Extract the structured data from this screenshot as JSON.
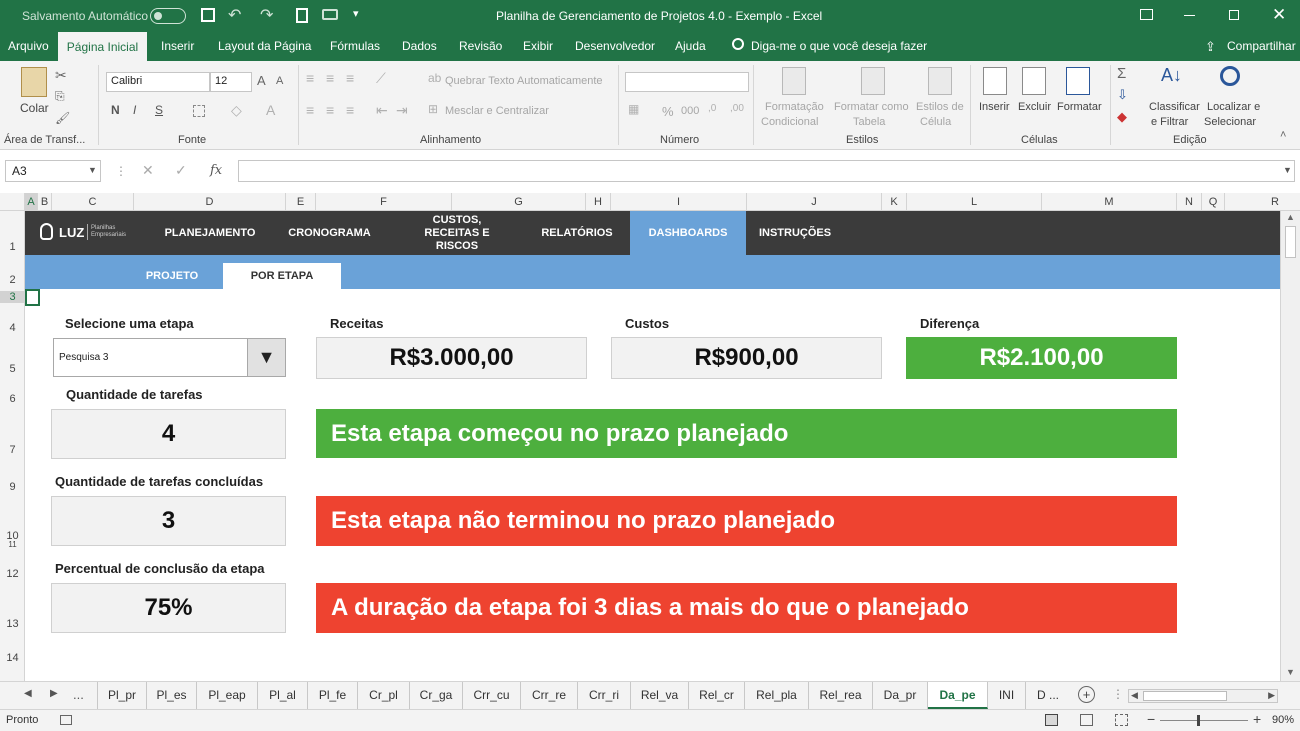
{
  "titlebar": {
    "autosave_label": "Salvamento Automático",
    "autosave_state": "Desativado",
    "title": "Planilha de Gerenciamento de Projetos 4.0 - Exemplo  -  Excel"
  },
  "menu": {
    "tabs": [
      "Arquivo",
      "Página Inicial",
      "Inserir",
      "Layout da Página",
      "Fórmulas",
      "Dados",
      "Revisão",
      "Exibir",
      "Desenvolvedor",
      "Ajuda"
    ],
    "active_tab": "Página Inicial",
    "tell_me": "Diga-me o que você deseja fazer",
    "share": "Compartilhar"
  },
  "ribbon": {
    "paste": "Colar",
    "clipboard": "Área de Transf...",
    "font_name": "Calibri",
    "font_size": "12",
    "bold": "N",
    "italic": "I",
    "underline": "S",
    "font_group": "Fonte",
    "wrap_text": "Quebrar Texto Automaticamente",
    "merge_center": "Mesclar e Centralizar",
    "alignment_group": "Alinhamento",
    "number_format": "",
    "percent": "%",
    "thousands": "000",
    "number_group": "Número",
    "cond_format": [
      "Formatação",
      "Condicional"
    ],
    "format_table": [
      "Formatar como",
      "Tabela"
    ],
    "cell_styles": [
      "Estilos de",
      "Célula"
    ],
    "styles_group": "Estilos",
    "insert": "Inserir",
    "delete": "Excluir",
    "format": "Formatar",
    "cells_group": "Células",
    "sort_filter": [
      "Classificar",
      "e Filtrar"
    ],
    "find_select": [
      "Localizar e",
      "Selecionar"
    ],
    "editing_group": "Edição"
  },
  "formula_bar": {
    "name_box": "A3",
    "fx": "fx",
    "content": ""
  },
  "columns": [
    "A",
    "B",
    "C",
    "D",
    "E",
    "F",
    "G",
    "H",
    "I",
    "J",
    "K",
    "L",
    "M",
    "N",
    "Q",
    "R"
  ],
  "rows": [
    "1",
    "2",
    "3",
    "4",
    "5",
    "6",
    "7",
    "9",
    "10",
    "11",
    "12",
    "13",
    "14"
  ],
  "nav": {
    "logo": "LUZ",
    "logo_sub": [
      "Planilhas",
      "Empresariais"
    ],
    "items": [
      "PLANEJAMENTO",
      "CRONOGRAMA",
      "CUSTOS, RECEITAS E RISCOS",
      "RELATÓRIOS",
      "DASHBOARDS",
      "INSTRUÇÕES"
    ],
    "active": "DASHBOARDS",
    "subtabs": [
      "PROJETO",
      "POR ETAPA"
    ],
    "active_subtab": "POR ETAPA"
  },
  "dashboard": {
    "select_label": "Selecione uma etapa",
    "selected_stage": "Pesquisa 3",
    "tasks_label": "Quantidade de tarefas",
    "tasks_value": "4",
    "done_label": "Quantidade de tarefas concluídas",
    "done_value": "3",
    "percent_label": "Percentual de conclusão da etapa",
    "percent_value": "75%",
    "revenue_label": "Receitas",
    "revenue_value": "R$3.000,00",
    "costs_label": "Custos",
    "costs_value": "R$900,00",
    "diff_label": "Diferença",
    "diff_value": "R$2.100,00",
    "banners": [
      "Esta etapa começou no prazo planejado",
      "Esta etapa não terminou no prazo planejado",
      "A duração da etapa foi 3 dias a mais do que o planejado"
    ]
  },
  "colors": {
    "excel_green": "#217346",
    "nav_dark": "#3b3b3b",
    "nav_blue": "#6aa2d8",
    "ok_green": "#4daf3e",
    "alert_red": "#ee4330"
  },
  "sheet_tabs": [
    "Pl_pr",
    "Pl_es",
    "Pl_eap",
    "Pl_al",
    "Pl_fe",
    "Cr_pl",
    "Cr_ga",
    "Crr_cu",
    "Crr_re",
    "Crr_ri",
    "Rel_va",
    "Rel_cr",
    "Rel_pla",
    "Rel_rea",
    "Da_pr",
    "Da_pe",
    "INI",
    "D ..."
  ],
  "active_sheet": "Da_pe",
  "sheet_nav_more": "...",
  "status": {
    "ready": "Pronto",
    "zoom": "90%"
  }
}
